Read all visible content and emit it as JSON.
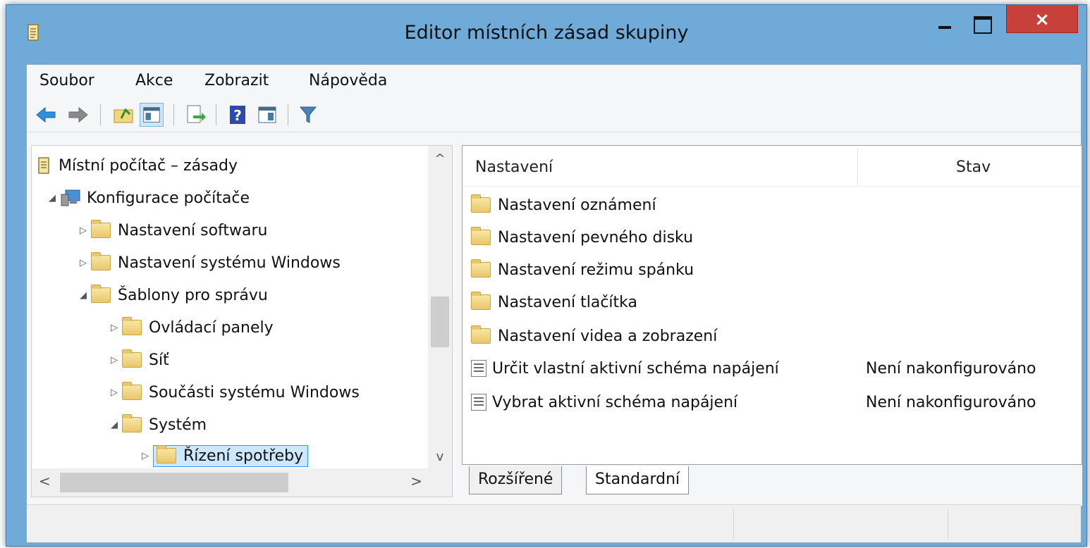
{
  "window": {
    "title": "Editor místních zásad skupiny",
    "close_glyph": "×"
  },
  "menu": {
    "items": [
      "Soubor",
      "Akce",
      "Zobrazit",
      "Nápověda"
    ]
  },
  "toolbar": {
    "icons": [
      "back-arrow-icon",
      "forward-arrow-icon",
      "up-folder-icon",
      "show-hide-tree-icon",
      "export-list-icon",
      "help-icon",
      "show-action-pane-icon",
      "filter-icon"
    ]
  },
  "tree": {
    "root": "Místní počítač – zásady",
    "items": [
      {
        "label": "Konfigurace počítače",
        "arrow": "◢"
      },
      {
        "label": "Nastavení softwaru",
        "arrow": "▷"
      },
      {
        "label": "Nastavení systému Windows",
        "arrow": "▷"
      },
      {
        "label": "Šablony pro správu",
        "arrow": "◢"
      },
      {
        "label": "Ovládací panely",
        "arrow": "▷"
      },
      {
        "label": "Síť",
        "arrow": "▷"
      },
      {
        "label": "Součásti systému Windows",
        "arrow": "▷"
      },
      {
        "label": "Systém",
        "arrow": "◢"
      },
      {
        "label": "Řízení spotřeby",
        "arrow": "▷"
      }
    ],
    "scroll_up": "^",
    "scroll_down": "v",
    "scroll_left": "<",
    "scroll_right": ">"
  },
  "list": {
    "col_setting": "Nastavení",
    "col_state": "Stav",
    "rows": [
      {
        "label": "Nastavení oznámení",
        "status": ""
      },
      {
        "label": "Nastavení pevného disku",
        "status": ""
      },
      {
        "label": "Nastavení režimu spánku",
        "status": ""
      },
      {
        "label": "Nastavení tlačítka",
        "status": ""
      },
      {
        "label": "Nastavení videa a zobrazení",
        "status": ""
      },
      {
        "label": "Určit vlastní aktivní schéma napájení",
        "status": "Není nakonfigurováno"
      },
      {
        "label": "Vybrat aktivní schéma napájení",
        "status": "Není nakonfigurováno"
      }
    ]
  },
  "tabs": {
    "extended": "Rozšířené",
    "standard": "Standardní"
  }
}
